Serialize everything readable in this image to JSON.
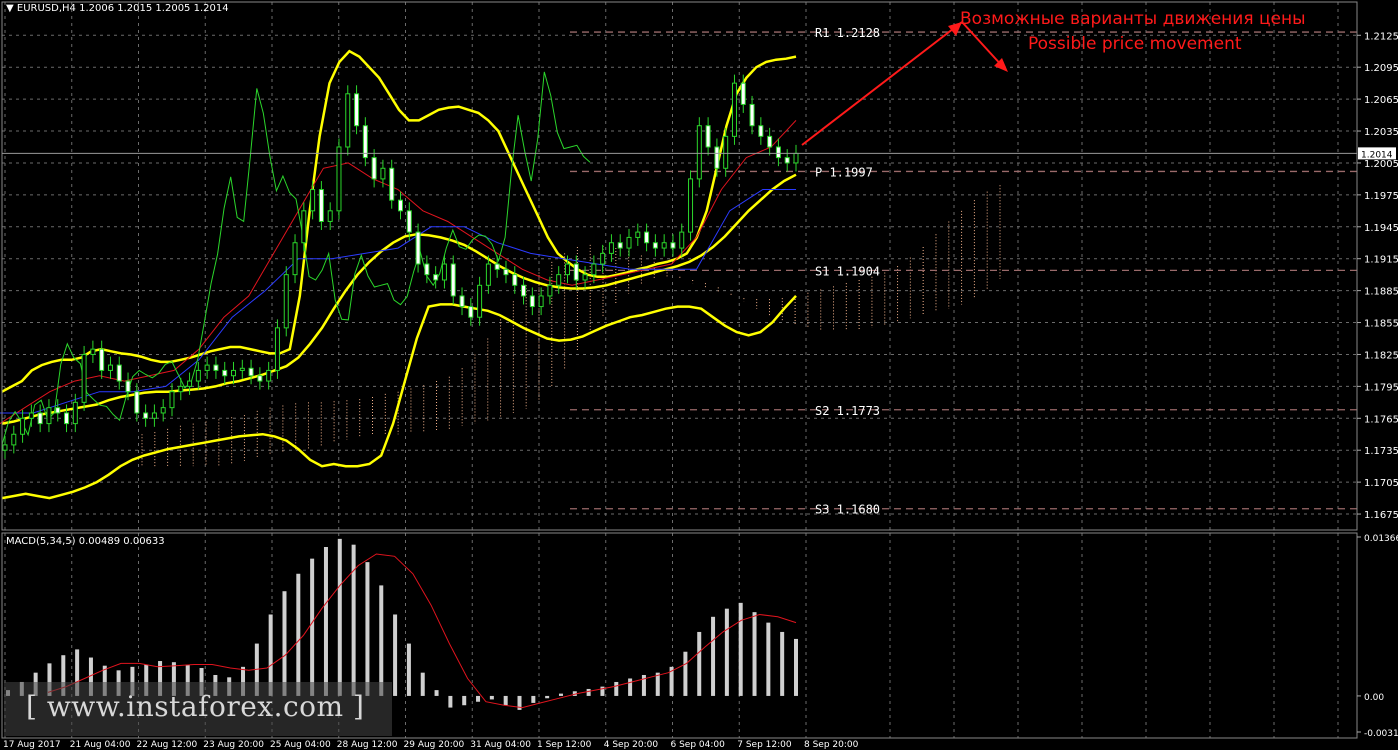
{
  "header": {
    "symbol": "EURUSD,H4",
    "ohlc": "1.2006 1.2015 1.2005 1.2014",
    "macd_label": "MACD(5,34,5) 0.00489 0.00633"
  },
  "annotations": {
    "ru": "Возможные варианты движения цены",
    "en": "Possible price movement"
  },
  "watermark": "[ www.instaforex.com ]",
  "colors": {
    "background": "#000000",
    "grid": "#6b6b6b",
    "bollinger": "#ffff00",
    "chikou": "#2bd62b",
    "tenkan": "#e0141e",
    "kijun": "#2b3bff",
    "cloud": "#f4b38c",
    "pivot_line": "#9a6a6a",
    "macd_hist": "#d0d0d0",
    "macd_signal": "#e0141e",
    "annotation": "#ff1a1a"
  },
  "chart_data": [
    {
      "type": "candlestick",
      "title": "EURUSD,H4",
      "ylim": [
        1.166,
        1.2145
      ],
      "y_ticks": [
        "1.2125",
        "1.2095",
        "1.2065",
        "1.2035",
        "1.2005",
        "1.1975",
        "1.1945",
        "1.1915",
        "1.1885",
        "1.1855",
        "1.1825",
        "1.1795",
        "1.1765",
        "1.1735",
        "1.1705",
        "1.1675"
      ],
      "current_price": "1.2014",
      "x_ticks": [
        "17 Aug 2017",
        "21 Aug 04:00",
        "22 Aug 12:00",
        "23 Aug 20:00",
        "25 Aug 04:00",
        "28 Aug 12:00",
        "29 Aug 20:00",
        "31 Aug 04:00",
        "1 Sep 12:00",
        "4 Sep 20:00",
        "6 Sep 04:00",
        "7 Sep 12:00",
        "8 Sep 20:00"
      ],
      "pivot_levels": [
        {
          "label": "R1",
          "value": "1.2128",
          "price": 1.2128
        },
        {
          "label": "P",
          "value": "1.1997",
          "price": 1.1997
        },
        {
          "label": "S1",
          "value": "1.1904",
          "price": 1.1904
        },
        {
          "label": "S2",
          "value": "1.1773",
          "price": 1.1773
        },
        {
          "label": "S3",
          "value": "1.1680",
          "price": 1.168
        }
      ],
      "close": [
        1.174,
        1.175,
        1.1765,
        1.177,
        1.176,
        1.1775,
        1.177,
        1.176,
        1.178,
        1.1825,
        1.183,
        1.181,
        1.1815,
        1.18,
        1.179,
        1.177,
        1.1765,
        1.177,
        1.1775,
        1.179,
        1.1795,
        1.18,
        1.181,
        1.1815,
        1.181,
        1.1805,
        1.181,
        1.1812,
        1.1805,
        1.18,
        1.181,
        1.185,
        1.19,
        1.193,
        1.196,
        1.198,
        1.195,
        1.196,
        1.202,
        1.207,
        1.204,
        1.201,
        1.199,
        1.2,
        1.197,
        1.196,
        1.194,
        1.191,
        1.19,
        1.1895,
        1.191,
        1.188,
        1.187,
        1.186,
        1.189,
        1.191,
        1.1905,
        1.19,
        1.189,
        1.188,
        1.187,
        1.188,
        1.189,
        1.19,
        1.191,
        1.1895,
        1.19,
        1.191,
        1.192,
        1.193,
        1.1925,
        1.1935,
        1.194,
        1.193,
        1.1925,
        1.193,
        1.1925,
        1.194,
        1.199,
        1.204,
        1.202,
        1.2,
        1.203,
        1.208,
        1.206,
        1.204,
        1.203,
        1.202,
        1.201,
        1.2005,
        1.2014
      ],
      "series": [
        {
          "name": "Bollinger upper",
          "values": [
            1.179,
            1.1795,
            1.18,
            1.181,
            1.1815,
            1.1818,
            1.182,
            1.182,
            1.1822,
            1.1828,
            1.183,
            1.1828,
            1.1826,
            1.1825,
            1.1823,
            1.182,
            1.1818,
            1.1818,
            1.182,
            1.1822,
            1.1825,
            1.1828,
            1.183,
            1.1832,
            1.1832,
            1.183,
            1.1828,
            1.1826,
            1.1826,
            1.183,
            1.188,
            1.196,
            1.203,
            1.208,
            1.21,
            1.211,
            1.2105,
            1.2095,
            1.2085,
            1.207,
            1.2055,
            1.2045,
            1.2045,
            1.205,
            1.2055,
            1.2057,
            1.2058,
            1.2055,
            1.2052,
            1.2045,
            1.2035,
            1.2015,
            1.1995,
            1.1975,
            1.1955,
            1.1935,
            1.192,
            1.1912,
            1.1905,
            1.19,
            1.1898,
            1.1898,
            1.19,
            1.1902,
            1.1905,
            1.1907,
            1.191,
            1.1912,
            1.1915,
            1.192,
            1.1935,
            1.196,
            1.2,
            1.204,
            1.207,
            1.2085,
            1.2095,
            1.21,
            1.2102,
            1.2103,
            1.2105
          ]
        },
        {
          "name": "Bollinger middle",
          "values": [
            1.176,
            1.1762,
            1.1765,
            1.1768,
            1.177,
            1.1772,
            1.1774,
            1.1776,
            1.1778,
            1.1782,
            1.1785,
            1.1787,
            1.1789,
            1.179,
            1.179,
            1.1791,
            1.1792,
            1.1793,
            1.1795,
            1.1798,
            1.18,
            1.1803,
            1.1806,
            1.181,
            1.1814,
            1.1822,
            1.1835,
            1.185,
            1.1868,
            1.1885,
            1.19,
            1.1912,
            1.1922,
            1.193,
            1.1936,
            1.1938,
            1.1937,
            1.1935,
            1.1932,
            1.1928,
            1.1922,
            1.1915,
            1.1908,
            1.1902,
            1.1897,
            1.1893,
            1.189,
            1.1888,
            1.1887,
            1.1887,
            1.1888,
            1.189,
            1.1893,
            1.1896,
            1.1899,
            1.1902,
            1.1905,
            1.1908,
            1.1912,
            1.1918,
            1.1926,
            1.1936,
            1.1948,
            1.196,
            1.197,
            1.198,
            1.1988,
            1.1994
          ]
        },
        {
          "name": "Bollinger lower",
          "values": [
            1.169,
            1.1692,
            1.1694,
            1.1692,
            1.169,
            1.1693,
            1.1696,
            1.17,
            1.1705,
            1.1712,
            1.172,
            1.1726,
            1.173,
            1.1733,
            1.1736,
            1.1738,
            1.174,
            1.1742,
            1.1744,
            1.1746,
            1.1748,
            1.1749,
            1.175,
            1.1748,
            1.1744,
            1.1736,
            1.1726,
            1.172,
            1.1722,
            1.172,
            1.172,
            1.1722,
            1.173,
            1.176,
            1.18,
            1.184,
            1.187,
            1.1872,
            1.1872,
            1.187,
            1.1868,
            1.1866,
            1.1862,
            1.1856,
            1.185,
            1.1845,
            1.184,
            1.1838,
            1.1839,
            1.1842,
            1.1847,
            1.1852,
            1.1856,
            1.186,
            1.1862,
            1.1865,
            1.1868,
            1.187,
            1.187,
            1.1868,
            1.186,
            1.1852,
            1.1846,
            1.1843,
            1.1846,
            1.1855,
            1.1868,
            1.188
          ]
        },
        {
          "name": "Tenkan-sen",
          "values": [
            1.176,
            1.1775,
            1.179,
            1.18,
            1.1805,
            1.18,
            1.1805,
            1.181,
            1.183,
            1.186,
            1.188,
            1.192,
            1.196,
            1.2,
            1.2005,
            1.199,
            1.198,
            1.196,
            1.195,
            1.1935,
            1.192,
            1.1905,
            1.1895,
            1.189,
            1.1895,
            1.19,
            1.1905,
            1.191,
            1.1935,
            1.198,
            1.201,
            1.202,
            1.2045
          ]
        },
        {
          "name": "Kijun-sen",
          "values": [
            1.177,
            1.177,
            1.178,
            1.179,
            1.179,
            1.1795,
            1.182,
            1.186,
            1.1885,
            1.1915,
            1.1915,
            1.192,
            1.1925,
            1.1945,
            1.1945,
            1.193,
            1.192,
            1.1915,
            1.191,
            1.1905,
            1.1905,
            1.1905,
            1.196,
            1.198,
            1.198
          ]
        }
      ]
    },
    {
      "type": "bar",
      "title": "MACD(5,34,5)",
      "ylim": [
        -0.0031,
        0.01366
      ],
      "y_ticks": [
        "0.01366",
        "0.00",
        "-0.0031"
      ],
      "series": [
        {
          "name": "MACD",
          "values": [
            0.0005,
            0.0012,
            0.002,
            0.0028,
            0.0035,
            0.004,
            0.0033,
            0.0026,
            0.0022,
            0.0025,
            0.0027,
            0.003,
            0.0029,
            0.0027,
            0.0024,
            0.0018,
            0.0016,
            0.0025,
            0.0045,
            0.007,
            0.009,
            0.0105,
            0.0118,
            0.0128,
            0.0135,
            0.013,
            0.0115,
            0.0095,
            0.007,
            0.0045,
            0.002,
            0.0005,
            -0.001,
            -0.0008,
            -0.0005,
            -0.0003,
            -0.0008,
            -0.0012,
            -0.0006,
            -0.0002,
            0.0002,
            0.0004,
            0.0006,
            0.0008,
            0.0012,
            0.0015,
            0.0018,
            0.002,
            0.0025,
            0.0038,
            0.0055,
            0.0068,
            0.0075,
            0.008,
            0.0072,
            0.0063,
            0.0055,
            0.0049
          ]
        },
        {
          "name": "Signal",
          "values": [
            0.0003,
            0.0008,
            0.0015,
            0.0022,
            0.0028,
            0.0028,
            0.0025,
            0.0026,
            0.0027,
            0.0027,
            0.0024,
            0.0022,
            0.0024,
            0.0035,
            0.0052,
            0.0075,
            0.0095,
            0.0112,
            0.0122,
            0.012,
            0.0105,
            0.0078,
            0.0045,
            0.0015,
            -0.0005,
            -0.0008,
            -0.001,
            -0.0006,
            -0.0002,
            0.0002,
            0.0005,
            0.0008,
            0.0012,
            0.0016,
            0.002,
            0.0028,
            0.0042,
            0.0055,
            0.0065,
            0.007,
            0.0068,
            0.0063
          ]
        }
      ]
    }
  ]
}
